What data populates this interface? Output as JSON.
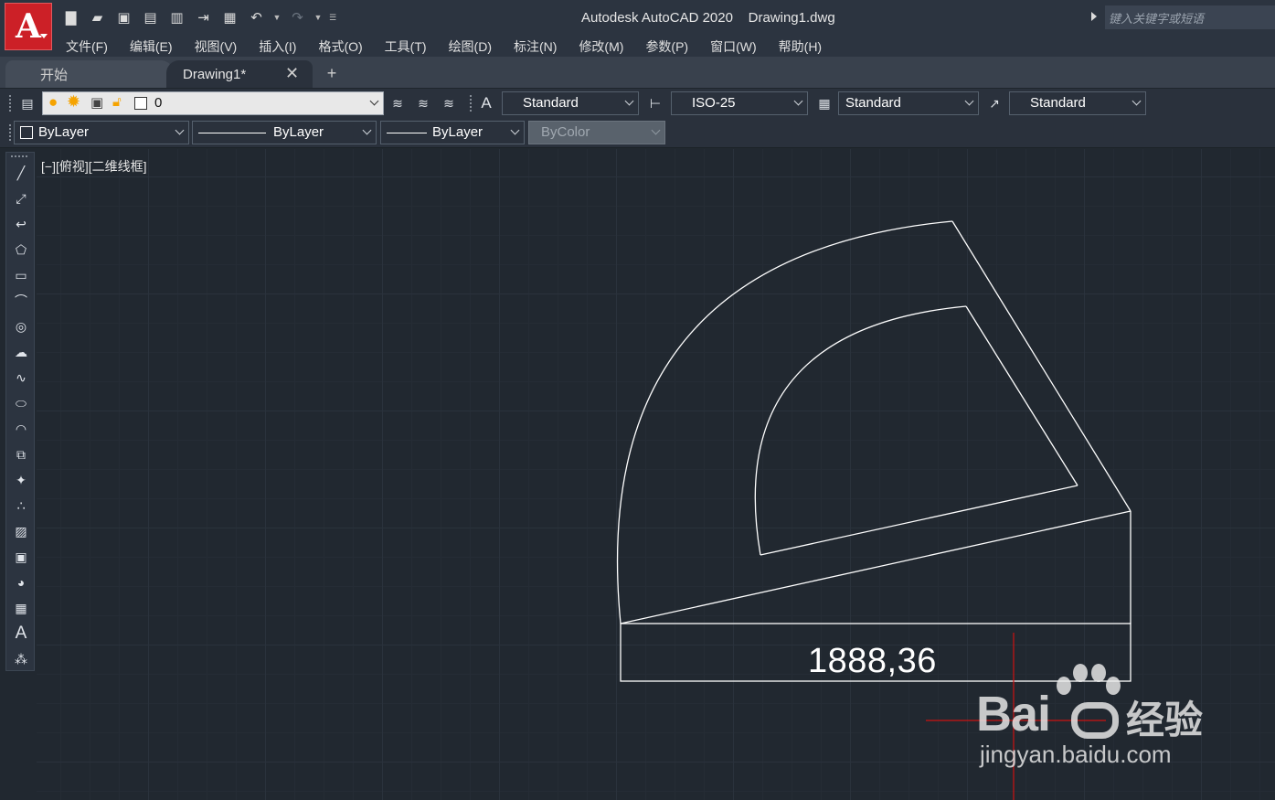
{
  "app": {
    "logo_letter": "A",
    "title": "Autodesk AutoCAD 2020    Drawing1.dwg",
    "search_placeholder": "键入关键字或短语"
  },
  "menu": [
    "文件(F)",
    "编辑(E)",
    "视图(V)",
    "插入(I)",
    "格式(O)",
    "工具(T)",
    "绘图(D)",
    "标注(N)",
    "修改(M)",
    "参数(P)",
    "窗口(W)",
    "帮助(H)"
  ],
  "tabs": {
    "start": "开始",
    "drawing": "Drawing1*",
    "close_glyph": "✕",
    "add_glyph": "+"
  },
  "toolbar": {
    "layer_value": "0",
    "text_style": "Standard",
    "dim_style": "ISO-25",
    "table_style": "Standard",
    "multileader_style": "Standard",
    "color": "ByLayer",
    "linetype": "ByLayer",
    "lineweight": "ByLayer",
    "plot_style": "ByColor"
  },
  "viewport": {
    "label": "[−][俯视][二维线框]"
  },
  "canvas": {
    "coordinate_readout": "1888,36"
  },
  "watermark": {
    "logo": "Bai",
    "logo_suffix": "经验",
    "url": "jingyan.baidu.com"
  },
  "colors": {
    "canvas_bg": "#212830",
    "logo_red": "#cc2027",
    "crosshair": "#cc1111",
    "linework": "#ffffff"
  }
}
